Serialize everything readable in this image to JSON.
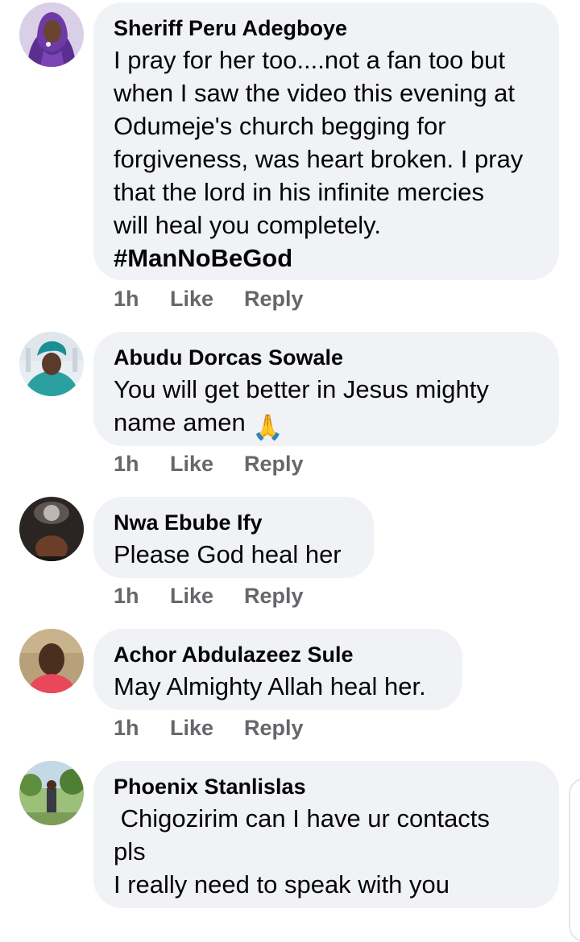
{
  "comments": [
    {
      "author": "Sheriff Peru Adegboye",
      "text_lines": [
        "I pray for her too....not a fan too but",
        "when I saw the video this evening at",
        "Odumeje's church begging for",
        "forgiveness, was heart broken. I pray",
        "that the lord in his infinite mercies",
        "will heal you completely."
      ],
      "hashtag": "#ManNoBeGod",
      "time": "1h",
      "like_label": "Like",
      "reply_label": "Reply",
      "avatar_icon": "profile-photo-woman-purple-hijab"
    },
    {
      "author": "Abudu Dorcas Sowale",
      "text_lines": [
        "You will get better in Jesus mighty",
        "name amen"
      ],
      "emoji": "🙏",
      "emoji_name": "folded-hands",
      "time": "1h",
      "like_label": "Like",
      "reply_label": "Reply",
      "avatar_icon": "profile-photo-woman-teal-headwrap"
    },
    {
      "author": "Nwa Ebube Ify",
      "text_lines": [
        "Please God heal her"
      ],
      "time": "1h",
      "like_label": "Like",
      "reply_label": "Reply",
      "avatar_icon": "profile-photo-dark-selfie"
    },
    {
      "author": "Achor Abdulazeez Sule",
      "text_lines": [
        "May Almighty Allah heal her."
      ],
      "time": "1h",
      "like_label": "Like",
      "reply_label": "Reply",
      "avatar_icon": "profile-photo-man-red-shirt"
    },
    {
      "author": "Phoenix Stanlislas",
      "text_lines": [
        " Chigozirim can I have ur contacts",
        "pls",
        "I really need to speak with you"
      ],
      "avatar_icon": "profile-photo-man-outdoors"
    }
  ],
  "colors": {
    "bubble": "#f0f2f5",
    "text": "#050505",
    "meta": "#65676b"
  }
}
